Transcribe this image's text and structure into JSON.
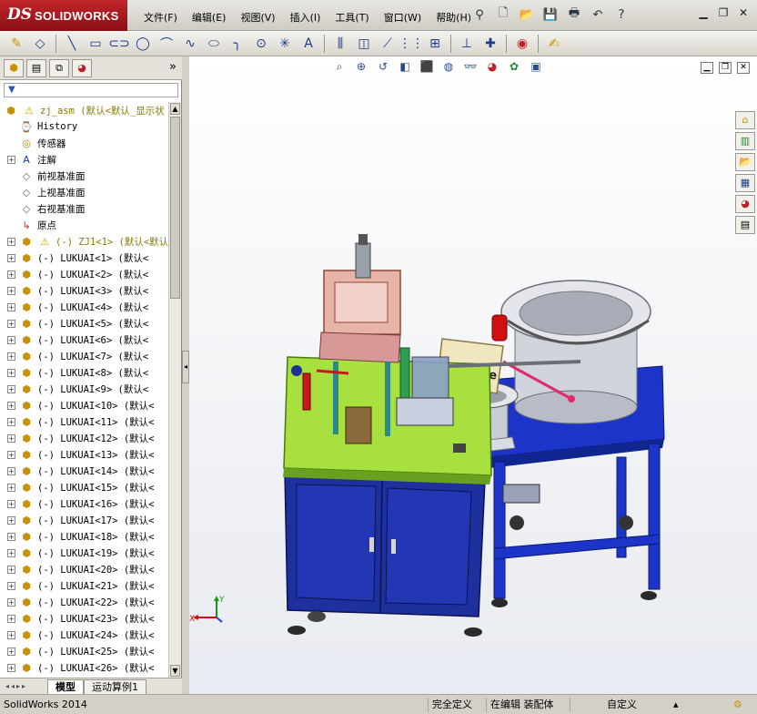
{
  "app": {
    "logo_ds": "DS",
    "logo_name": "SOLIDWORKS"
  },
  "menu": [
    "文件(F)",
    "编辑(E)",
    "视图(V)",
    "插入(I)",
    "工具(T)",
    "窗口(W)",
    "帮助(H)"
  ],
  "quick_access_icons": [
    "pushpin-icon",
    "new-document-icon",
    "open-folder-icon",
    "save-icon",
    "print-icon",
    "undo-icon",
    "help-icon"
  ],
  "window_controls": [
    "minimize-icon",
    "restore-icon",
    "close-icon"
  ],
  "command_icons": [
    "sketch-icon",
    "smart-dimension-icon",
    "line-icon",
    "rectangle-icon",
    "slot-icon",
    "circle-icon",
    "arc-icon",
    "spline-icon",
    "ellipse-icon",
    "fillet-icon",
    "point-icon",
    "centerline-icon",
    "text-icon",
    "mirror-icon",
    "offset-icon",
    "convert-icon",
    "pattern-icon",
    "move-icon",
    "relations-icon",
    "repair-icon",
    "rapid-sketch-icon",
    "instant2d-icon"
  ],
  "panel_tabs": [
    "feature-manager-icon",
    "property-manager-icon",
    "configuration-manager-icon",
    "display-manager-icon"
  ],
  "panel_more": "»",
  "filter": "▼",
  "tree": {
    "root": "zj_asm  (默认<默认_显示状",
    "items": [
      {
        "label": "History",
        "icon": "history-icon",
        "type": "hist"
      },
      {
        "label": "传感器",
        "icon": "sensor-icon",
        "type": "sens"
      },
      {
        "label": "注解",
        "icon": "annotation-icon",
        "type": "note",
        "expand": true
      },
      {
        "label": "前视基准面",
        "icon": "plane-icon",
        "type": "plane"
      },
      {
        "label": "上视基准面",
        "icon": "plane-icon",
        "type": "plane"
      },
      {
        "label": "右视基准面",
        "icon": "plane-icon",
        "type": "plane"
      },
      {
        "label": "原点",
        "icon": "origin-icon",
        "type": "orig"
      },
      {
        "label": "(-) ZJ1<1> (默认<默认",
        "icon": "component-icon",
        "type": "comp",
        "warn": true,
        "expand": true
      },
      {
        "label": "(-) LUKUAI<1> (默认<",
        "icon": "component-icon",
        "type": "comp",
        "expand": true
      },
      {
        "label": "(-) LUKUAI<2> (默认<",
        "icon": "component-icon",
        "type": "comp",
        "expand": true
      },
      {
        "label": "(-) LUKUAI<3> (默认<",
        "icon": "component-icon",
        "type": "comp",
        "expand": true
      },
      {
        "label": "(-) LUKUAI<4> (默认<",
        "icon": "component-icon",
        "type": "comp",
        "expand": true
      },
      {
        "label": "(-) LUKUAI<5> (默认<",
        "icon": "component-icon",
        "type": "comp",
        "expand": true
      },
      {
        "label": "(-) LUKUAI<6> (默认<",
        "icon": "component-icon",
        "type": "comp",
        "expand": true
      },
      {
        "label": "(-) LUKUAI<7> (默认<",
        "icon": "component-icon",
        "type": "comp",
        "expand": true
      },
      {
        "label": "(-) LUKUAI<8> (默认<",
        "icon": "component-icon",
        "type": "comp",
        "expand": true
      },
      {
        "label": "(-) LUKUAI<9> (默认<",
        "icon": "component-icon",
        "type": "comp",
        "expand": true
      },
      {
        "label": "(-) LUKUAI<10> (默认<",
        "icon": "component-icon",
        "type": "comp",
        "expand": true
      },
      {
        "label": "(-) LUKUAI<11> (默认<",
        "icon": "component-icon",
        "type": "comp",
        "expand": true
      },
      {
        "label": "(-) LUKUAI<12> (默认<",
        "icon": "component-icon",
        "type": "comp",
        "expand": true
      },
      {
        "label": "(-) LUKUAI<13> (默认<",
        "icon": "component-icon",
        "type": "comp",
        "expand": true
      },
      {
        "label": "(-) LUKUAI<14> (默认<",
        "icon": "component-icon",
        "type": "comp",
        "expand": true
      },
      {
        "label": "(-) LUKUAI<15> (默认<",
        "icon": "component-icon",
        "type": "comp",
        "expand": true
      },
      {
        "label": "(-) LUKUAI<16> (默认<",
        "icon": "component-icon",
        "type": "comp",
        "expand": true
      },
      {
        "label": "(-) LUKUAI<17> (默认<",
        "icon": "component-icon",
        "type": "comp",
        "expand": true
      },
      {
        "label": "(-) LUKUAI<18> (默认<",
        "icon": "component-icon",
        "type": "comp",
        "expand": true
      },
      {
        "label": "(-) LUKUAI<19> (默认<",
        "icon": "component-icon",
        "type": "comp",
        "expand": true
      },
      {
        "label": "(-) LUKUAI<20> (默认<",
        "icon": "component-icon",
        "type": "comp",
        "expand": true
      },
      {
        "label": "(-) LUKUAI<21> (默认<",
        "icon": "component-icon",
        "type": "comp",
        "expand": true
      },
      {
        "label": "(-) LUKUAI<22> (默认<",
        "icon": "component-icon",
        "type": "comp",
        "expand": true
      },
      {
        "label": "(-) LUKUAI<23> (默认<",
        "icon": "component-icon",
        "type": "comp",
        "expand": true
      },
      {
        "label": "(-) LUKUAI<24> (默认<",
        "icon": "component-icon",
        "type": "comp",
        "expand": true
      },
      {
        "label": "(-) LUKUAI<25> (默认<",
        "icon": "component-icon",
        "type": "comp",
        "expand": true
      },
      {
        "label": "(-) LUKUAI<26> (默认<",
        "icon": "component-icon",
        "type": "comp",
        "expand": true
      }
    ]
  },
  "bottom_tabs": {
    "model": "模型",
    "motion": "运动算例1"
  },
  "heads_up_icons": [
    "zoom-to-fit-icon",
    "zoom-area-icon",
    "previous-view-icon",
    "section-view-icon",
    "view-orientation-icon",
    "display-style-icon",
    "hide-show-icon",
    "appearance-icon",
    "scene-icon",
    "view-settings-icon"
  ],
  "task_pane_icons": [
    "home-icon",
    "design-library-icon",
    "file-explorer-icon",
    "view-palette-icon",
    "appearances-icon",
    "custom-properties-icon"
  ],
  "triad": {
    "x": "X",
    "y": "Y"
  },
  "machine_label": "proface",
  "colors": {
    "table_top": "#a8e040",
    "cabinet": "#1e2f9e",
    "frame_blue": "#1c34c8",
    "plate_pink": "#e8b4a8",
    "bowl_grey": "#c8ccd4"
  },
  "status": {
    "app_version": "SolidWorks 2014",
    "definition": "完全定义",
    "mode": "在编辑 装配体",
    "custom": "自定义"
  }
}
